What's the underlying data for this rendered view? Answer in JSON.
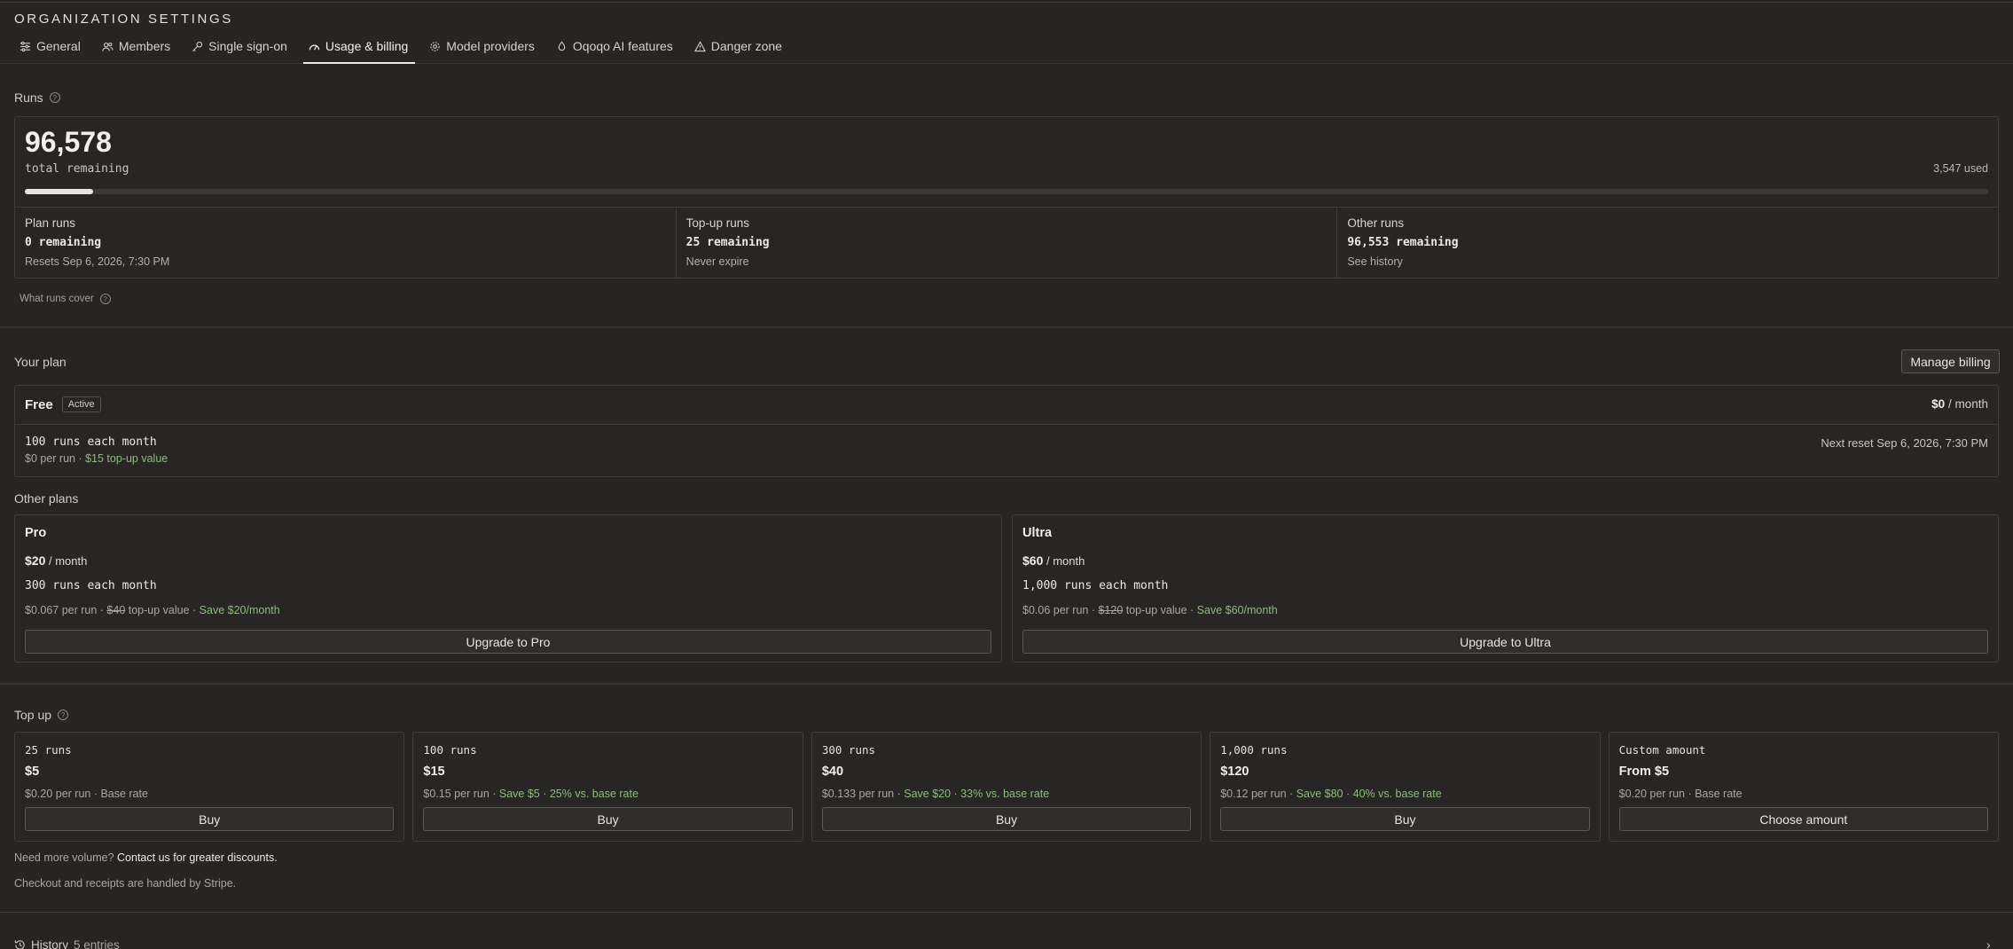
{
  "header": {
    "title": "ORGANIZATION SETTINGS",
    "tabs": [
      {
        "label": "General",
        "icon": "sliders-icon"
      },
      {
        "label": "Members",
        "icon": "users-icon"
      },
      {
        "label": "Single sign-on",
        "icon": "key-icon"
      },
      {
        "label": "Usage & billing",
        "icon": "gauge-icon",
        "active": true
      },
      {
        "label": "Model providers",
        "icon": "gear-icon"
      },
      {
        "label": "Oqoqo AI features",
        "icon": "sparkle-icon"
      },
      {
        "label": "Danger zone",
        "icon": "warning-icon"
      }
    ]
  },
  "runs": {
    "label": "Runs",
    "total": "96,578",
    "total_caption": "total remaining",
    "used": "3,547 used",
    "used_fraction": 0.035,
    "columns": [
      {
        "title": "Plan runs",
        "value": "0 remaining",
        "note": "Resets Sep 6, 2026, 7:30 PM"
      },
      {
        "title": "Top-up runs",
        "value": "25 remaining",
        "note": "Never expire"
      },
      {
        "title": "Other runs",
        "value": "96,553 remaining",
        "note": "See history"
      }
    ],
    "what_covers": "What runs cover"
  },
  "plan": {
    "label": "Your plan",
    "manage_button": "Manage billing",
    "name": "Free",
    "badge": "Active",
    "price": "$0",
    "price_unit": "/ month",
    "runs_line": "100 runs each month",
    "per_run": "$0 per run · ",
    "topup_value": "$15 top-up value",
    "next_reset": "Next reset Sep 6, 2026, 7:30 PM"
  },
  "other_plans": {
    "label": "Other plans",
    "plans": [
      {
        "name": "Pro",
        "price": "$20",
        "unit": "/ month",
        "runs": "300 runs each month",
        "per_run": "$0.067 per run · ",
        "strike": "$40",
        "topup": " top-up value · ",
        "save": "Save $20/month",
        "button": "Upgrade to Pro"
      },
      {
        "name": "Ultra",
        "price": "$60",
        "unit": "/ month",
        "runs": "1,000 runs each month",
        "per_run": "$0.06 per run · ",
        "strike": "$120",
        "topup": " top-up value · ",
        "save": "Save $60/month",
        "button": "Upgrade to Ultra"
      }
    ]
  },
  "topup": {
    "label": "Top up",
    "options": [
      {
        "title": "25 runs",
        "price": "$5",
        "per_run": "$0.20 per run · ",
        "extra": "Base rate",
        "extra_green": false,
        "button": "Buy"
      },
      {
        "title": "100 runs",
        "price": "$15",
        "per_run": "$0.15 per run · ",
        "extra": "Save $5 · 25% vs. base rate",
        "extra_green": true,
        "button": "Buy"
      },
      {
        "title": "300 runs",
        "price": "$40",
        "per_run": "$0.133 per run · ",
        "extra": "Save $20 · 33% vs. base rate",
        "extra_green": true,
        "button": "Buy"
      },
      {
        "title": "1,000 runs",
        "price": "$120",
        "per_run": "$0.12 per run · ",
        "extra": "Save $80 · 40% vs. base rate",
        "extra_green": true,
        "button": "Buy"
      },
      {
        "title": "Custom amount",
        "price": "From $5",
        "per_run": "$0.20 per run · ",
        "extra": "Base rate",
        "extra_green": false,
        "button": "Choose amount"
      }
    ],
    "volume_text": "Need more volume? ",
    "volume_link": "Contact us for greater discounts.",
    "stripe_note": "Checkout and receipts are handled by Stripe."
  },
  "history": {
    "label": "History",
    "count": "5 entries"
  }
}
